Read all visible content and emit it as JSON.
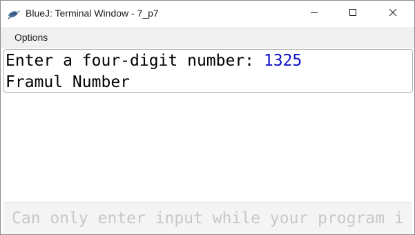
{
  "window": {
    "title": "BlueJ: Terminal Window - 7_p7",
    "app_icon": "bluej-bird-icon",
    "controls": {
      "minimize_icon": "minimize-icon",
      "maximize_icon": "maximize-icon",
      "close_icon": "close-icon"
    }
  },
  "menubar": {
    "items": [
      {
        "label": "Options"
      }
    ]
  },
  "terminal": {
    "lines": [
      {
        "prompt": "Enter a four-digit number: ",
        "input": "1325"
      },
      {
        "text": "Framul Number"
      }
    ],
    "input_color": "#1010c8"
  },
  "input_area": {
    "placeholder": "Can only enter input while your program i"
  },
  "colors": {
    "menubar_bg": "#f0f0f0",
    "input_area_bg": "#f4f4f4",
    "input_text": "#1010c8"
  }
}
